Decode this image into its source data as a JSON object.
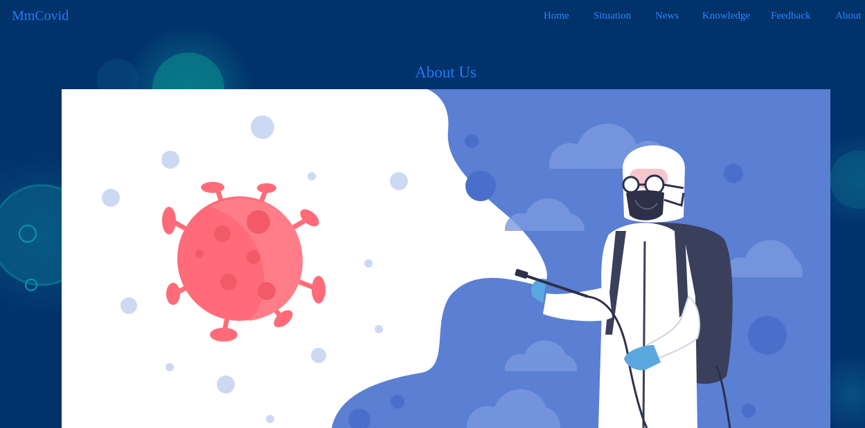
{
  "navbar": {
    "brand": "MmCovid",
    "links": [
      {
        "label": "Home"
      },
      {
        "label": "Situation"
      },
      {
        "label": "News"
      },
      {
        "label": "Knowledge"
      },
      {
        "label": "Feedback"
      },
      {
        "label": "About"
      }
    ]
  },
  "main": {
    "title": "About Us"
  },
  "colors": {
    "background": "#02326a",
    "link": "#2a86ff",
    "hero_blue": "#5a7fd3",
    "virus_red": "#ff6b78"
  },
  "icons": {
    "hero": "disinfection-illustration",
    "background": "virus-pattern"
  }
}
